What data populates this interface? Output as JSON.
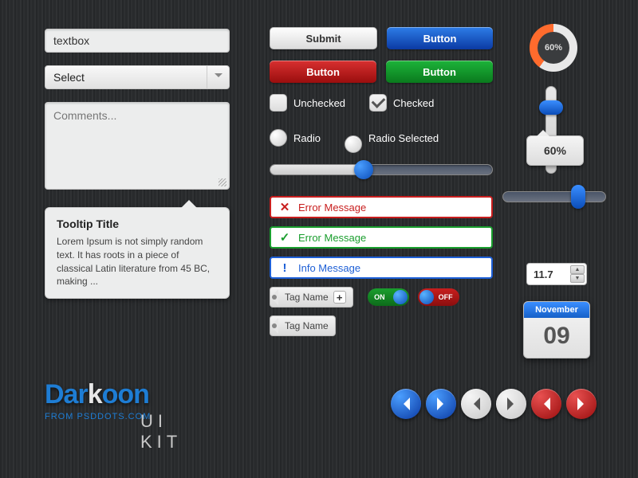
{
  "textbox": {
    "value": "textbox"
  },
  "select": {
    "value": "Select"
  },
  "textarea": {
    "placeholder": "Comments..."
  },
  "tooltip": {
    "title": "Tooltip Title",
    "body": "Lorem Ipsum is not simply random text. It has roots in a piece of classical Latin literature from 45 BC, making ..."
  },
  "buttons": {
    "submit": "Submit",
    "blue": "Button",
    "red": "Button",
    "green": "Button"
  },
  "checks": {
    "unchecked": "Unchecked",
    "checked": "Checked",
    "radio": "Radio",
    "radio_selected": "Radio Selected"
  },
  "messages": {
    "error": "Error Message",
    "success": "Error Message",
    "info": "Info Message"
  },
  "tags": {
    "t1": "Tag Name",
    "t2": "Tag Name"
  },
  "toggles": {
    "on": "ON",
    "off": "OFF"
  },
  "gauge": "60%",
  "bubble": "60%",
  "stepper": "11.7",
  "calendar": {
    "month": "November",
    "day": "09"
  },
  "brand": {
    "name_a": "Dar",
    "name_k": "k",
    "name_b": "oon",
    "from": "FROM PSDDOTS.COM",
    "kit": "UI KIT"
  }
}
